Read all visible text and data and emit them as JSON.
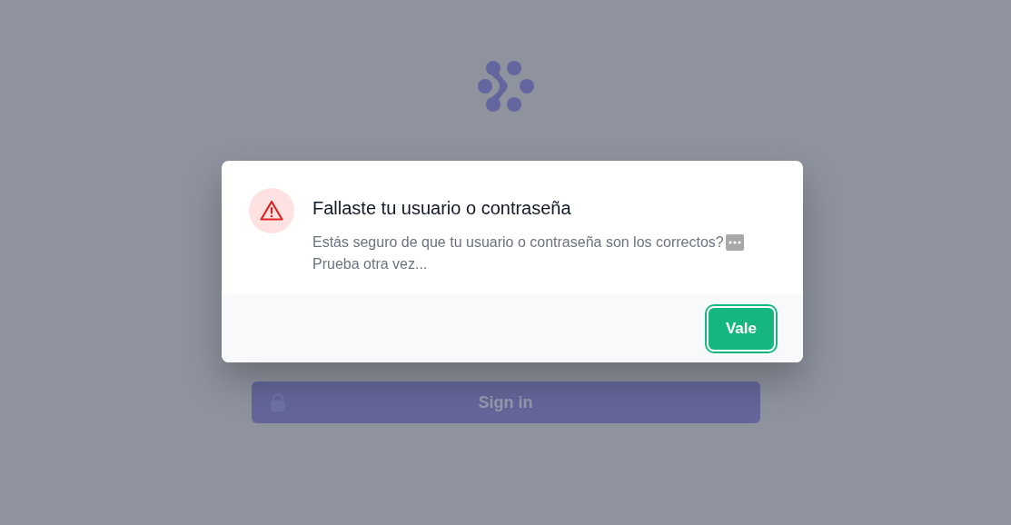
{
  "page": {
    "sign_in_button": "Sign in"
  },
  "dialog": {
    "title": "Fallaste tu usuario o contraseña",
    "message_lines": [
      "Estás seguro de que tu usuario o contraseña son los correctos?",
      "Prueba otra vez..."
    ],
    "confirm_button": "Vale"
  }
}
